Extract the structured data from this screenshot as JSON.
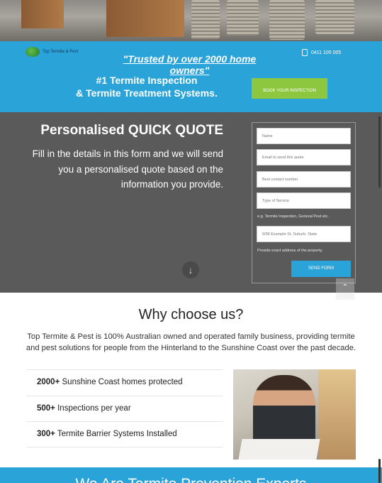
{
  "header": {
    "logo_text": "Top Termite & Pest",
    "trusted": "\"Trusted by over 2000 home owners\"",
    "phone": "0411 105 005",
    "tagline_line1": "#1 Termite Inspection",
    "tagline_line2": "& Termite Treatment Systems.",
    "book_button": "BOOK YOUR INSPECTION"
  },
  "quote": {
    "title": "Personalised QUICK QUOTE",
    "description": "Fill in the details in this form and we will send you a personalised quote based on the information you provide.",
    "form": {
      "name_placeholder": "Name",
      "email_placeholder": "Email to send this quote",
      "phone_placeholder": "Best contact number",
      "service_placeholder": "Type of Service",
      "service_hint": "e.g. Termite Inspection, General Pest etc.",
      "address_placeholder": "9/99 Example St, Suburb, State.",
      "address_hint": "Provide exact address of the property.",
      "send_button": "SEND FORM"
    }
  },
  "why": {
    "title": "Why choose us?",
    "text": "Top Termite & Pest is 100% Australian owned and operated family business, providing termite and pest solutions for people from the Hinterland to the Sunshine Coast over the past decade.",
    "stats": [
      {
        "bold": "2000+",
        "rest": " Sunshine Coast homes protected"
      },
      {
        "bold": "500+",
        "rest": " Inspections per year"
      },
      {
        "bold": "300+",
        "rest": " Termite Barrier Systems Installed"
      }
    ]
  },
  "bottom": {
    "title": "We Are Termite Prevention Experts"
  },
  "colors": {
    "brand_blue": "#29a3d8",
    "cta_green": "#8dc63f",
    "section_grey": "#5a5a5a"
  }
}
